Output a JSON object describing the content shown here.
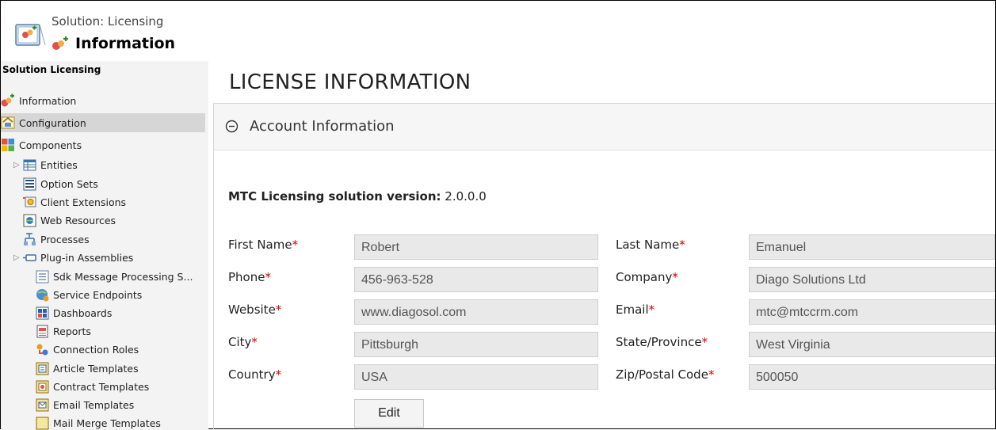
{
  "header": {
    "subtitle": "Solution: Licensing",
    "title": "Information"
  },
  "sidebar": {
    "heading": "Solution Licensing",
    "items": [
      {
        "label": "Information",
        "icon": "info-icon"
      },
      {
        "label": "Configuration",
        "icon": "configuration-icon"
      },
      {
        "label": "Components",
        "icon": "components-icon"
      }
    ],
    "subitems": [
      {
        "label": "Entities",
        "icon": "entities-icon",
        "expandable": true
      },
      {
        "label": "Option Sets",
        "icon": "option-sets-icon"
      },
      {
        "label": "Client Extensions",
        "icon": "client-extensions-icon"
      },
      {
        "label": "Web Resources",
        "icon": "web-resources-icon"
      },
      {
        "label": "Processes",
        "icon": "processes-icon"
      },
      {
        "label": "Plug-in Assemblies",
        "icon": "plugin-assemblies-icon",
        "expandable": true
      },
      {
        "label": "Sdk Message Processing S...",
        "icon": "sdk-message-icon"
      },
      {
        "label": "Service Endpoints",
        "icon": "service-endpoints-icon"
      },
      {
        "label": "Dashboards",
        "icon": "dashboards-icon"
      },
      {
        "label": "Reports",
        "icon": "reports-icon"
      },
      {
        "label": "Connection Roles",
        "icon": "connection-roles-icon"
      },
      {
        "label": "Article Templates",
        "icon": "article-templates-icon"
      },
      {
        "label": "Contract Templates",
        "icon": "contract-templates-icon"
      },
      {
        "label": "Email Templates",
        "icon": "email-templates-icon"
      },
      {
        "label": "Mail Merge Templates",
        "icon": "mail-merge-icon"
      }
    ]
  },
  "main": {
    "page_title": "LICENSE INFORMATION",
    "section_title": "Account Information",
    "version_label": "MTC Licensing solution version:",
    "version_value": "2.0.0.0",
    "fields": [
      {
        "label": "First Name",
        "value": "Robert"
      },
      {
        "label": "Last Name",
        "value": "Emanuel"
      },
      {
        "label": "Phone",
        "value": "456-963-528"
      },
      {
        "label": "Company",
        "value": "Diago Solutions Ltd"
      },
      {
        "label": "Website",
        "value": "www.diagosol.com"
      },
      {
        "label": "Email",
        "value": "mtc@mtccrm.com"
      },
      {
        "label": "City",
        "value": "Pittsburgh"
      },
      {
        "label": "State/Province",
        "value": "West Virginia"
      },
      {
        "label": "Country",
        "value": "USA"
      },
      {
        "label": "Zip/Postal Code",
        "value": "500050"
      }
    ],
    "required_mark": "*",
    "edit_label": "Edit"
  },
  "colors": {
    "required": "#d00000",
    "sidebar_bg": "#f3f3f3",
    "selected_bg": "#d6d6d6",
    "field_bg": "#e9e9e9"
  }
}
